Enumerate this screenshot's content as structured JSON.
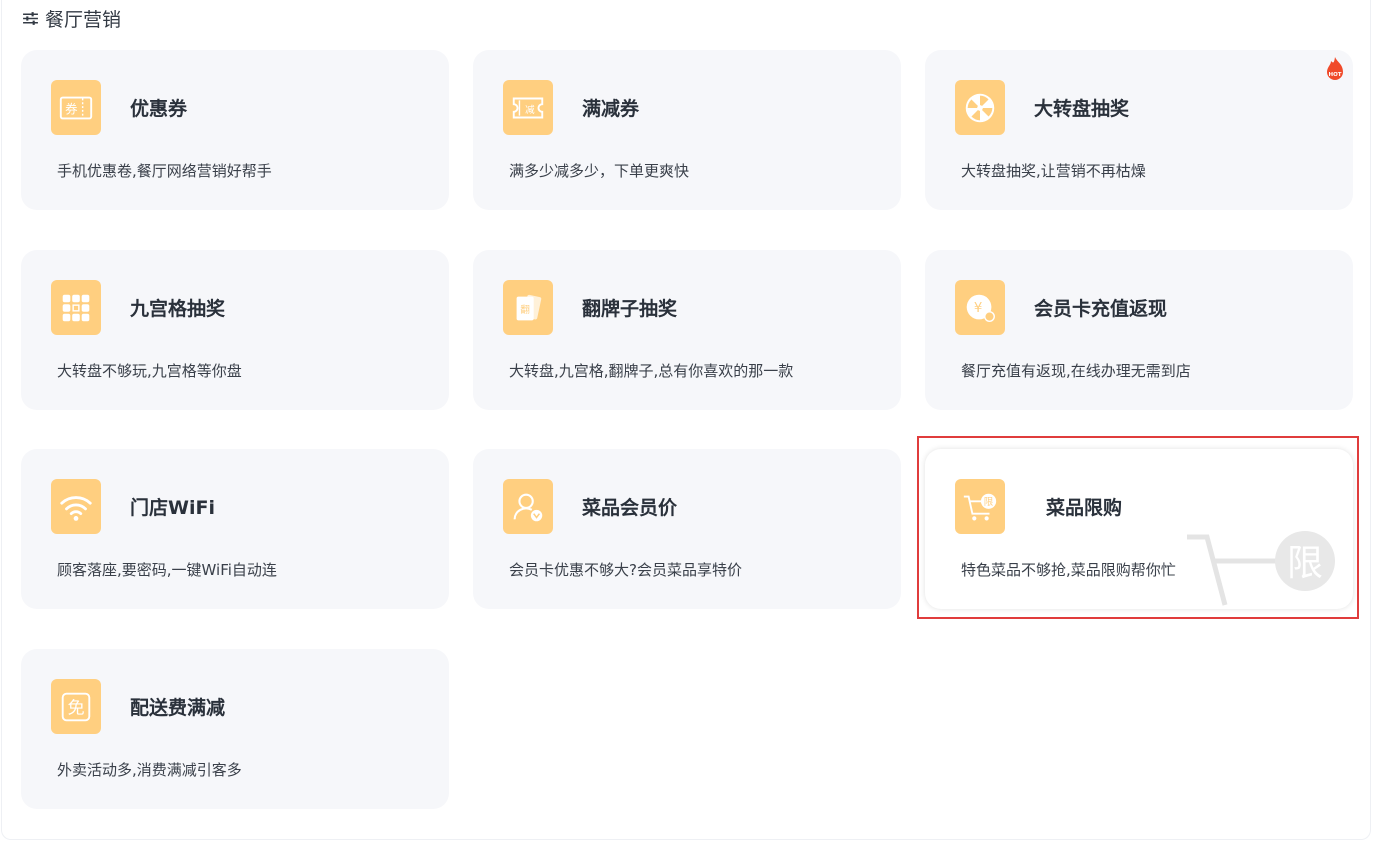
{
  "header": {
    "title": "餐厅营销",
    "icon": "sliders-icon"
  },
  "cards": [
    {
      "title": "优惠券",
      "desc": "手机优惠卷,餐厅网络营销好帮手",
      "icon": "coupon-icon"
    },
    {
      "title": "满减券",
      "desc": "满多少减多少，下单更爽快",
      "icon": "discount-ticket-icon",
      "icon_text": "减"
    },
    {
      "title": "大转盘抽奖",
      "desc": "大转盘抽奖,让营销不再枯燥",
      "icon": "wheel-icon",
      "badge": "HOT"
    },
    {
      "title": "九宫格抽奖",
      "desc": "大转盘不够玩,九宫格等你盘",
      "icon": "grid-icon"
    },
    {
      "title": "翻牌子抽奖",
      "desc": "大转盘,九宫格,翻牌子,总有你喜欢的那一款",
      "icon": "flip-card-icon",
      "icon_text": "翻"
    },
    {
      "title": "会员卡充值返现",
      "desc": "餐厅充值有返现,在线办理无需到店",
      "icon": "cashback-coin-icon",
      "icon_text": "¥"
    },
    {
      "title": "门店WiFi",
      "desc": "顾客落座,要密码,一键WiFi自动连",
      "icon": "wifi-icon"
    },
    {
      "title": "菜品会员价",
      "desc": "会员卡优惠不够大?会员菜品享特价",
      "icon": "member-user-icon"
    },
    {
      "title": "菜品限购",
      "desc": "特色菜品不够抢,菜品限购帮你忙",
      "icon": "limited-cart-icon",
      "icon_text": "限"
    },
    {
      "title": "配送费满减",
      "desc": "外卖活动多,消费满减引客多",
      "icon": "free-delivery-icon",
      "icon_text": "免"
    }
  ],
  "colors": {
    "icon_bg": "#ffcf80",
    "card_bg": "#f6f7fa",
    "highlight": "#e03c3c",
    "hot": "#f04a2a"
  }
}
